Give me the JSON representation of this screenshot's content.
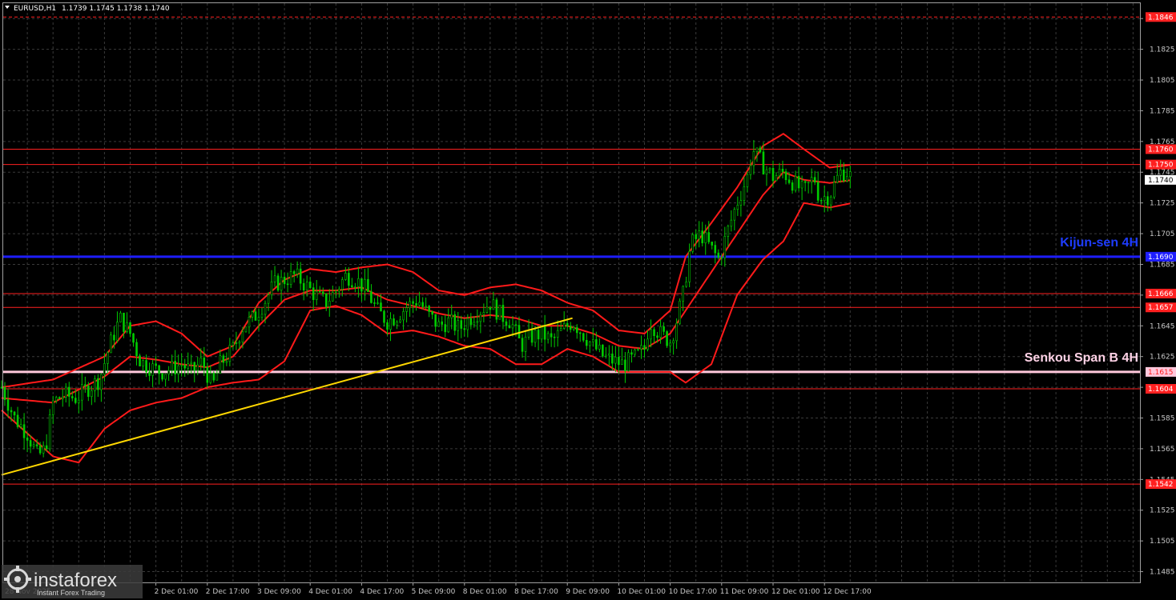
{
  "header": {
    "symbol_title": "EURUSD,H1",
    "ohlc": "1.1739 1.1745 1.1738 1.1740"
  },
  "chart_data": {
    "type": "candlestick",
    "symbol": "EURUSD",
    "timeframe": "H1",
    "y_ticks": [
      "1.1485",
      "1.1505",
      "1.1525",
      "1.1545",
      "1.1565",
      "1.1585",
      "1.1605",
      "1.1625",
      "1.1645",
      "1.1665",
      "1.1685",
      "1.1705",
      "1.1725",
      "1.1745",
      "1.1765",
      "1.1785",
      "1.1805",
      "1.1825",
      "1.1845"
    ],
    "ylim": [
      1.1478,
      1.1855
    ],
    "x_ticks": [
      "2 Dec 01:00",
      "2 Dec 17:00",
      "3 Dec 09:00",
      "4 Dec 01:00",
      "4 Dec 17:00",
      "5 Dec 09:00",
      "8 Dec 01:00",
      "8 Dec 17:00",
      "9 Dec 09:00",
      "10 Dec 01:00",
      "10 Dec 17:00",
      "11 Dec 09:00",
      "12 Dec 01:00",
      "12 Dec 17:00"
    ],
    "x_tick_positions": [
      3,
      4,
      5,
      6,
      7,
      8,
      9,
      10,
      11,
      12,
      13,
      14,
      15,
      16
    ],
    "first_x_label_partial": "28 Nov 2025",
    "current_price": "1.1740",
    "levels": [
      {
        "label": "1.1846",
        "value": 1.1846,
        "color": "#ff2020",
        "style": "dashed"
      },
      {
        "label": "1.1760",
        "value": 1.176,
        "color": "#ff2020",
        "style": "solid"
      },
      {
        "label": "1.1750",
        "value": 1.175,
        "color": "#ff2020",
        "style": "solid"
      },
      {
        "label": "1.1690",
        "value": 1.169,
        "color": "#1e1eff",
        "style": "thick",
        "name": "Kijun-sen 4H"
      },
      {
        "label": "1.1666",
        "value": 1.1666,
        "color": "#ff2020",
        "style": "solid"
      },
      {
        "label": "1.1657",
        "value": 1.1657,
        "color": "#ff2020",
        "style": "solid"
      },
      {
        "label": "1.1615",
        "value": 1.1615,
        "color": "#ffc8dc",
        "style": "thick",
        "name": "Senkou Span B 4H"
      },
      {
        "label": "1.1604",
        "value": 1.1604,
        "color": "#ff2020",
        "style": "solid"
      },
      {
        "label": "1.1542",
        "value": 1.1542,
        "color": "#ff2020",
        "style": "solid"
      }
    ],
    "trendline": {
      "from": [
        0,
        1.1548
      ],
      "to": [
        11.1,
        1.165
      ],
      "color": "#ffd700"
    },
    "price_path": [
      [
        0,
        1.1605
      ],
      [
        0.25,
        1.1585
      ],
      [
        0.5,
        1.1575
      ],
      [
        0.7,
        1.156
      ],
      [
        0.85,
        1.1565
      ],
      [
        1.0,
        1.1595
      ],
      [
        1.2,
        1.16
      ],
      [
        1.45,
        1.1598
      ],
      [
        1.7,
        1.1605
      ],
      [
        1.9,
        1.161
      ],
      [
        2.1,
        1.1632
      ],
      [
        2.3,
        1.165
      ],
      [
        2.5,
        1.164
      ],
      [
        2.7,
        1.1622
      ],
      [
        2.9,
        1.1618
      ],
      [
        3.1,
        1.1615
      ],
      [
        3.3,
        1.1617
      ],
      [
        3.5,
        1.162
      ],
      [
        3.7,
        1.1615
      ],
      [
        3.9,
        1.1622
      ],
      [
        4.1,
        1.1605
      ],
      [
        4.25,
        1.162
      ],
      [
        4.5,
        1.163
      ],
      [
        4.7,
        1.1645
      ],
      [
        4.9,
        1.165
      ],
      [
        5.1,
        1.166
      ],
      [
        5.3,
        1.1672
      ],
      [
        5.5,
        1.1675
      ],
      [
        5.7,
        1.1678
      ],
      [
        5.9,
        1.1672
      ],
      [
        6.1,
        1.1665
      ],
      [
        6.3,
        1.166
      ],
      [
        6.5,
        1.1668
      ],
      [
        6.7,
        1.1678
      ],
      [
        6.9,
        1.1675
      ],
      [
        7.1,
        1.1668
      ],
      [
        7.3,
        1.1655
      ],
      [
        7.5,
        1.1648
      ],
      [
        7.7,
        1.1652
      ],
      [
        7.9,
        1.1658
      ],
      [
        8.1,
        1.1662
      ],
      [
        8.3,
        1.1652
      ],
      [
        8.5,
        1.1645
      ],
      [
        8.7,
        1.1648
      ],
      [
        8.9,
        1.1643
      ],
      [
        9.1,
        1.165
      ],
      [
        9.3,
        1.1655
      ],
      [
        9.5,
        1.166
      ],
      [
        9.7,
        1.1652
      ],
      [
        9.9,
        1.1648
      ],
      [
        10.1,
        1.1632
      ],
      [
        10.3,
        1.1638
      ],
      [
        10.5,
        1.164
      ],
      [
        10.7,
        1.1635
      ],
      [
        10.9,
        1.1642
      ],
      [
        11.1,
        1.1648
      ],
      [
        11.3,
        1.164
      ],
      [
        11.5,
        1.1632
      ],
      [
        11.7,
        1.1625
      ],
      [
        11.9,
        1.1622
      ],
      [
        12.1,
        1.162
      ],
      [
        12.3,
        1.1624
      ],
      [
        12.5,
        1.163
      ],
      [
        12.6,
        1.1648
      ],
      [
        12.8,
        1.164
      ],
      [
        13.0,
        1.1635
      ],
      [
        13.1,
        1.1645
      ],
      [
        13.25,
        1.1665
      ],
      [
        13.4,
        1.1698
      ],
      [
        13.6,
        1.1705
      ],
      [
        13.8,
        1.1695
      ],
      [
        13.95,
        1.1688
      ],
      [
        14.1,
        1.1705
      ],
      [
        14.3,
        1.1725
      ],
      [
        14.5,
        1.1742
      ],
      [
        14.6,
        1.176
      ],
      [
        14.8,
        1.175
      ],
      [
        15.0,
        1.1742
      ],
      [
        15.2,
        1.1745
      ],
      [
        15.4,
        1.1738
      ],
      [
        15.6,
        1.1732
      ],
      [
        15.8,
        1.1742
      ],
      [
        15.9,
        1.1728
      ],
      [
        16.1,
        1.173
      ],
      [
        16.3,
        1.1745
      ],
      [
        16.45,
        1.1745
      ],
      [
        16.55,
        1.174
      ]
    ],
    "bands": {
      "upper": [
        [
          0,
          1.1605
        ],
        [
          1.0,
          1.161
        ],
        [
          2.0,
          1.1625
        ],
        [
          2.5,
          1.1645
        ],
        [
          3.0,
          1.1648
        ],
        [
          3.5,
          1.164
        ],
        [
          4.0,
          1.1625
        ],
        [
          4.5,
          1.1632
        ],
        [
          5.0,
          1.166
        ],
        [
          5.5,
          1.1675
        ],
        [
          6.0,
          1.1682
        ],
        [
          6.5,
          1.168
        ],
        [
          7.0,
          1.1683
        ],
        [
          7.5,
          1.1685
        ],
        [
          8.0,
          1.168
        ],
        [
          8.5,
          1.1668
        ],
        [
          9.0,
          1.1665
        ],
        [
          9.5,
          1.167
        ],
        [
          10.0,
          1.1672
        ],
        [
          10.5,
          1.1668
        ],
        [
          11.0,
          1.166
        ],
        [
          11.5,
          1.1655
        ],
        [
          12.0,
          1.1642
        ],
        [
          12.5,
          1.164
        ],
        [
          13.0,
          1.1655
        ],
        [
          13.3,
          1.169
        ],
        [
          13.8,
          1.1712
        ],
        [
          14.3,
          1.1735
        ],
        [
          14.8,
          1.1762
        ],
        [
          15.2,
          1.177
        ],
        [
          15.6,
          1.176
        ],
        [
          16.1,
          1.1748
        ],
        [
          16.55,
          1.175
        ]
      ],
      "middle": [
        [
          0,
          1.1598
        ],
        [
          1.0,
          1.1595
        ],
        [
          2.0,
          1.1612
        ],
        [
          2.5,
          1.1625
        ],
        [
          3.0,
          1.1623
        ],
        [
          3.5,
          1.162
        ],
        [
          4.0,
          1.1618
        ],
        [
          4.5,
          1.1625
        ],
        [
          5.0,
          1.1645
        ],
        [
          5.5,
          1.1662
        ],
        [
          6.0,
          1.1668
        ],
        [
          6.5,
          1.1668
        ],
        [
          7.0,
          1.167
        ],
        [
          7.5,
          1.1662
        ],
        [
          8.0,
          1.1658
        ],
        [
          8.5,
          1.1653
        ],
        [
          9.0,
          1.165
        ],
        [
          9.5,
          1.1652
        ],
        [
          10.0,
          1.165
        ],
        [
          10.5,
          1.1645
        ],
        [
          11.0,
          1.1645
        ],
        [
          11.5,
          1.164
        ],
        [
          12.0,
          1.1632
        ],
        [
          12.5,
          1.163
        ],
        [
          13.0,
          1.164
        ],
        [
          13.3,
          1.1655
        ],
        [
          13.8,
          1.168
        ],
        [
          14.3,
          1.1705
        ],
        [
          14.8,
          1.173
        ],
        [
          15.2,
          1.1745
        ],
        [
          15.6,
          1.174
        ],
        [
          16.1,
          1.1738
        ],
        [
          16.55,
          1.174
        ]
      ],
      "lower": [
        [
          0,
          1.159
        ],
        [
          0.5,
          1.1575
        ],
        [
          1.0,
          1.156
        ],
        [
          1.5,
          1.1556
        ],
        [
          2.0,
          1.1578
        ],
        [
          2.5,
          1.159
        ],
        [
          3.0,
          1.1595
        ],
        [
          3.5,
          1.1598
        ],
        [
          4.0,
          1.1605
        ],
        [
          4.5,
          1.1608
        ],
        [
          5.0,
          1.161
        ],
        [
          5.5,
          1.1622
        ],
        [
          6.0,
          1.1655
        ],
        [
          6.5,
          1.1658
        ],
        [
          7.0,
          1.1652
        ],
        [
          7.5,
          1.164
        ],
        [
          8.0,
          1.1642
        ],
        [
          8.5,
          1.1638
        ],
        [
          9.0,
          1.1632
        ],
        [
          9.5,
          1.163
        ],
        [
          10.0,
          1.162
        ],
        [
          10.5,
          1.162
        ],
        [
          11.0,
          1.163
        ],
        [
          11.5,
          1.1625
        ],
        [
          12.0,
          1.1615
        ],
        [
          12.5,
          1.1615
        ],
        [
          13.0,
          1.1615
        ],
        [
          13.3,
          1.1608
        ],
        [
          13.8,
          1.162
        ],
        [
          14.3,
          1.1665
        ],
        [
          14.8,
          1.1688
        ],
        [
          15.2,
          1.17
        ],
        [
          15.6,
          1.1725
        ],
        [
          16.1,
          1.1722
        ],
        [
          16.55,
          1.1725
        ]
      ]
    }
  },
  "annotations": {
    "kijun": "Kijun-sen 4H",
    "senkou": "Senkou Span B 4H"
  },
  "branding": {
    "name": "instaforex",
    "tagline": "Instant Forex Trading"
  },
  "colors": {
    "background": "#000000",
    "grid": "#3a3a3a",
    "candle": "#00cc00",
    "bands": "#ff1a1a",
    "trendline": "#ffd700",
    "kijun": "#1e1eff",
    "senkou": "#ffc8dc"
  }
}
